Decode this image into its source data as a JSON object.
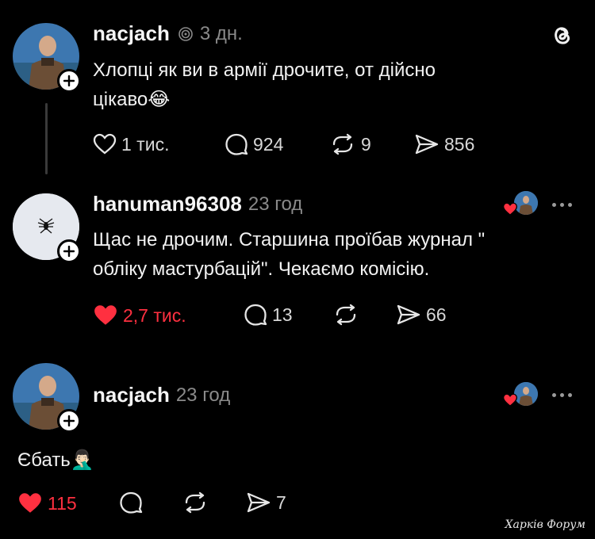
{
  "app_icon": "threads-icon",
  "posts": [
    {
      "username": "nacjach",
      "verified_icon": "verified-spiral-icon",
      "time": "3 дн.",
      "text_line1": "Хлопці як ви в армії дрочите, от дійсно",
      "text_line2": "цікаво",
      "emoji": "😂",
      "likes": "1 тис.",
      "comments": "924",
      "reposts": "9",
      "shares": "856",
      "liked": false
    },
    {
      "username": "hanuman96308",
      "time": "23 год",
      "text_line1": "Щас не дрочим. Старшина проїбав журнал \"",
      "text_line2": "обліку мастурбацій\". Чекаємо комісію.",
      "likes": "2,7 тис.",
      "comments": "13",
      "shares": "66",
      "liked": true
    },
    {
      "username": "nacjach",
      "time": "23 год",
      "text": "Єбать",
      "emoji": "🤦🏻‍♂️",
      "likes": "115",
      "shares": "7",
      "liked": true
    }
  ],
  "watermark": "Харків Форум",
  "colors": {
    "background": "#000000",
    "like_red": "#ff3040",
    "muted": "#8a8a8a"
  }
}
